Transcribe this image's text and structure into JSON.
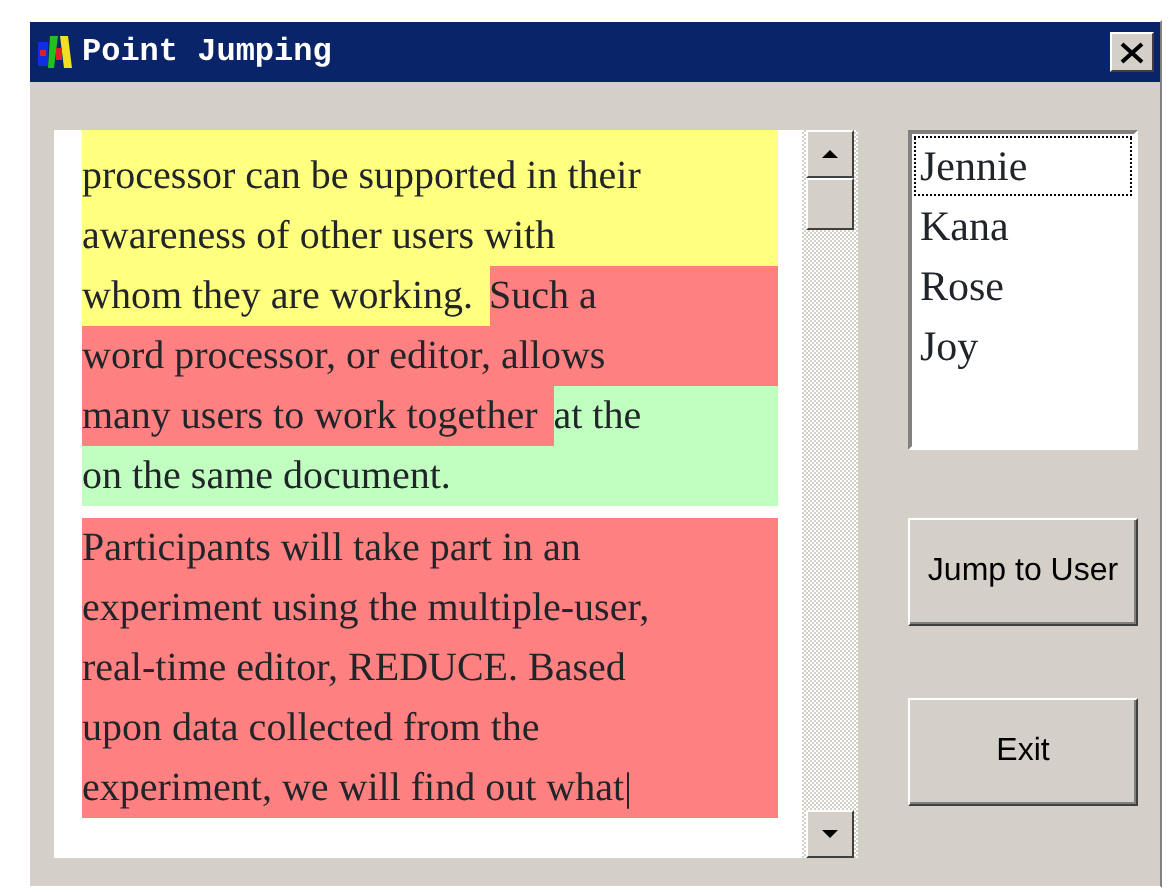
{
  "window": {
    "title": "Point Jumping"
  },
  "document": {
    "paragraphs": [
      {
        "lines": [
          {
            "segments": [
              {
                "text": "processor can be supported in their",
                "color": "#ffff80"
              }
            ]
          },
          {
            "segments": [
              {
                "text": "awareness of other users with",
                "color": "#ffff80"
              }
            ]
          },
          {
            "segments": [
              {
                "text": "whom they are working.",
                "color": "#ffff80"
              },
              {
                "text": "Such a",
                "color": "#ff8080"
              }
            ]
          },
          {
            "segments": [
              {
                "text": "word processor, or editor, allows",
                "color": "#ff8080"
              }
            ]
          },
          {
            "segments": [
              {
                "text": "many users to work together",
                "color": "#ff8080"
              },
              {
                "text": "at the",
                "color": "#c0ffc0"
              }
            ]
          },
          {
            "segments": [
              {
                "text": "on the same document.",
                "color": "#c0ffc0"
              }
            ]
          }
        ]
      },
      {
        "lines": [
          {
            "segments": [
              {
                "text": "Participants will take part in an",
                "color": "#ff8080"
              }
            ]
          },
          {
            "segments": [
              {
                "text": "experiment using the multiple-user,",
                "color": "#ff8080"
              }
            ]
          },
          {
            "segments": [
              {
                "text": "real-time editor, REDUCE. Based",
                "color": "#ff8080"
              }
            ]
          },
          {
            "segments": [
              {
                "text": "upon data collected from the",
                "color": "#ff8080"
              }
            ]
          },
          {
            "segments": [
              {
                "text": "experiment, we will find out what|",
                "color": "#ff8080"
              }
            ]
          }
        ]
      }
    ]
  },
  "users": [
    {
      "name": "Jennie",
      "selected": true
    },
    {
      "name": "Kana",
      "selected": false
    },
    {
      "name": "Rose",
      "selected": false
    },
    {
      "name": "Joy",
      "selected": false
    }
  ],
  "buttons": [
    "Jump to User",
    "Exit"
  ]
}
